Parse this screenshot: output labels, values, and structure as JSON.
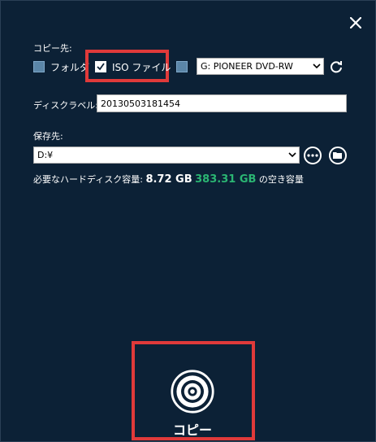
{
  "dialog": {
    "close_icon": "close-icon"
  },
  "copy_destination": {
    "heading": "コピー先:",
    "folder_label": "フォルダ",
    "folder_checked": false,
    "iso_label": "ISO ファイル",
    "iso_checked": true,
    "drive_checked": false,
    "drive_value": "G: PIONEER  DVD-RW"
  },
  "disc_label": {
    "heading": "ディスクラベル:",
    "value": "20130503181454"
  },
  "save_to": {
    "heading": "保存先:",
    "path_value": "D:¥"
  },
  "disk_space": {
    "prefix": "必要なハードディスク容量:",
    "required": "8.72 GB",
    "free": "383.31 GB",
    "suffix": "の空き容量"
  },
  "copy_button": {
    "label": "コピー"
  },
  "colors": {
    "background": "#0c2136",
    "highlight_red": "#e03a3a",
    "free_space_green": "#2bb673"
  }
}
